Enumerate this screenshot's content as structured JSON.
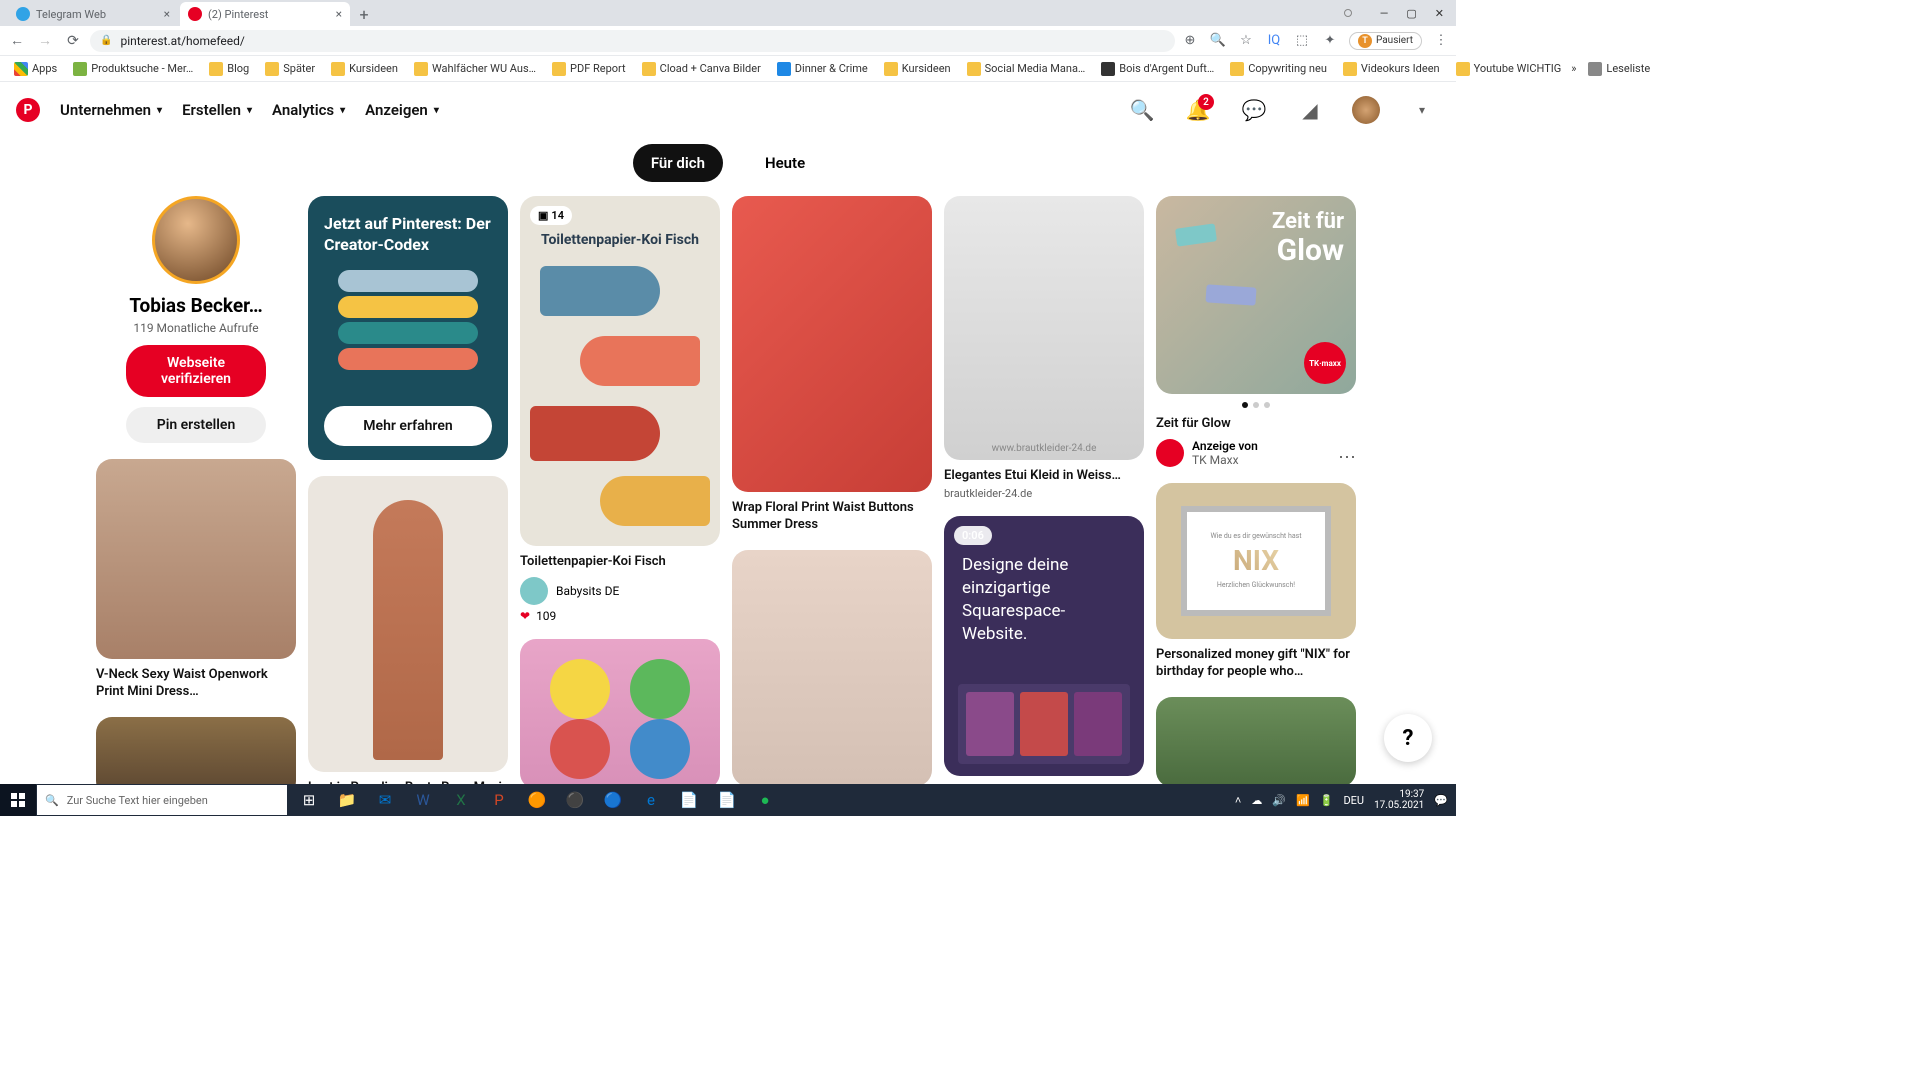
{
  "browser": {
    "tabs": [
      {
        "title": "Telegram Web",
        "favicon": "telegram"
      },
      {
        "title": "(2) Pinterest",
        "favicon": "pinterest",
        "active": true
      }
    ],
    "url": "pinterest.at/homefeed/",
    "pausiert": "Pausiert",
    "pausiert_initial": "T"
  },
  "bookmarks": {
    "apps": "Apps",
    "items": [
      "Produktsuche - Mer…",
      "Blog",
      "Später",
      "Kursideen",
      "Wahlfächer WU Aus…",
      "PDF Report",
      "Cload + Canva Bilder",
      "Dinner & Crime",
      "Kursideen",
      "Social Media Mana…",
      "Bois d'Argent Duft…",
      "Copywriting neu",
      "Videokurs Ideen",
      "Youtube WICHTIG"
    ],
    "leseliste": "Leseliste"
  },
  "nav": {
    "items": [
      "Unternehmen",
      "Erstellen",
      "Analytics",
      "Anzeigen"
    ],
    "notif_badge": "2"
  },
  "feedtabs": {
    "active": "Für dich",
    "other": "Heute"
  },
  "profile": {
    "name": "Tobias Becker…",
    "stat": "119 Monatliche Aufrufe",
    "verify_btn": "Webseite verifizieren",
    "create_btn": "Pin erstellen"
  },
  "codex": {
    "title": "Jetzt auf Pinterest: Der Creator-Codex",
    "cta": "Mehr erfahren"
  },
  "pins": {
    "vneck": "V-Neck Sexy Waist Openwork Print Mini Dress…",
    "rusty": "Lost in Paradise Rusty Rose Maxi",
    "koi_count": "14",
    "koi_overlay": "Toilettenpapier-Koi Fisch",
    "koi_title": "Toilettenpapier-Koi Fisch",
    "koi_author": "Babysits DE",
    "koi_likes": "109",
    "wrap": "Wrap Floral Print Waist Buttons Summer Dress",
    "etui": "Elegantes Etui Kleid in Weiss…",
    "etui_src": "brautkleider-24.de",
    "etui_watermark": "www.brautkleider-24.de",
    "sq_dur": "0:06",
    "sq_text": "Designe deine einzigartige Squarespace-Website.",
    "glow_overlay_top": "Zeit für",
    "glow_overlay_bottom": "Glow",
    "glow_title": "Zeit für Glow",
    "glow_ad_pre": "Anzeige von",
    "glow_ad_by": "TK Maxx",
    "glow_badge": "TK·maxx",
    "nix_frame_top": "Wie du es dir gewünscht hast",
    "nix_frame_word": "NIX",
    "nix_frame_bottom": "Herzlichen Glückwunsch!",
    "nix": "Personalized money gift \"NIX\" for birthday for people who…"
  },
  "taskbar": {
    "search_placeholder": "Zur Suche Text hier eingeben",
    "lang": "DEU",
    "time": "19:37",
    "date": "17.05.2021"
  },
  "help": "?"
}
